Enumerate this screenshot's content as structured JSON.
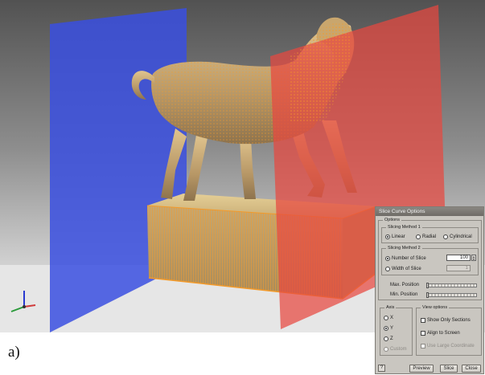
{
  "figure_label": "a)",
  "dialog": {
    "title": "Slice Curve Options",
    "options_group": "Options",
    "slicing_method_1": {
      "label": "Slicing Method 1",
      "options": [
        "Linear",
        "Radial",
        "Cylindrical"
      ],
      "selected": "Linear"
    },
    "slicing_method_2": {
      "label": "Slicing Method 2",
      "number_of_slice_label": "Number of Slice",
      "number_of_slice_value": "100",
      "width_of_slice_label": "Width of Slice",
      "width_of_slice_value": "1",
      "selected": "Number of Slice"
    },
    "max_position_label": "Max. Position",
    "min_position_label": "Min. Position",
    "axis": {
      "label": "Axis",
      "options": [
        "X",
        "Y",
        "Z",
        "Custom"
      ],
      "selected": "Y"
    },
    "view_options": {
      "label": "View options",
      "show_only_sections": "Show Only Sections",
      "align_to_screen": "Align to Screen",
      "use_large_coordinate": "Use Large Coordinate"
    },
    "buttons": {
      "help": "?",
      "preview": "Preview",
      "slice": "Slice",
      "close": "Close"
    }
  },
  "colors": {
    "blue_plane": "#3a4fe0",
    "red_plane": "#e84840",
    "model": "#c8a872",
    "points": "#f39a2a"
  }
}
